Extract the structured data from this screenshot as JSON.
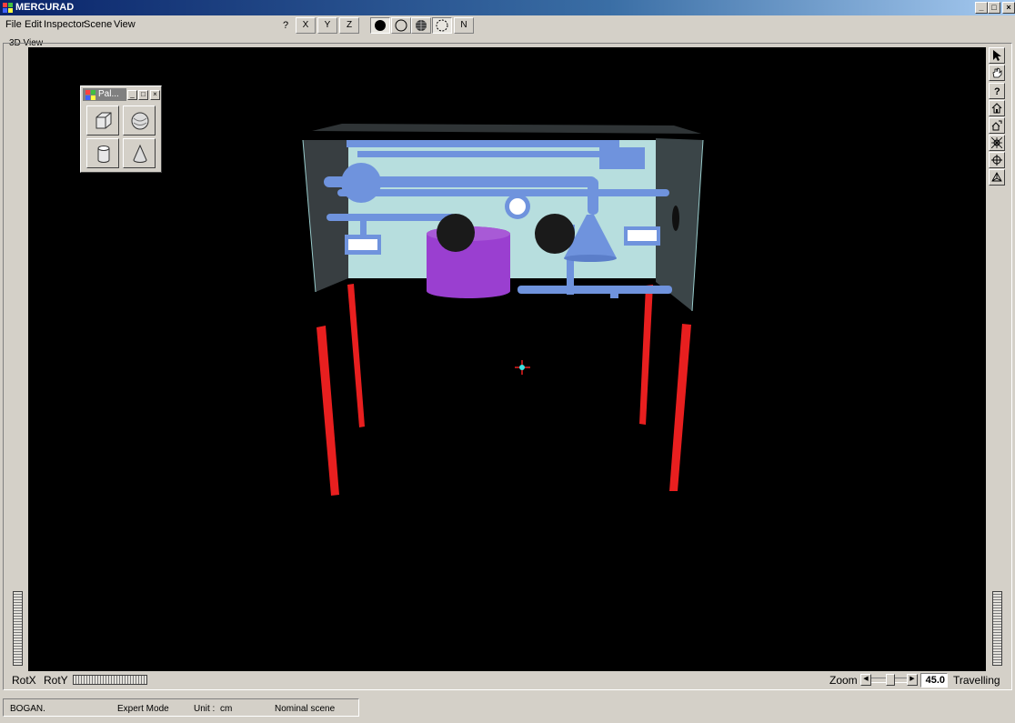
{
  "window": {
    "title": "MERCURAD"
  },
  "menu": {
    "items": [
      "File",
      "Edit",
      "Inspector",
      "Scene",
      "View"
    ],
    "help": "?"
  },
  "toolbar": {
    "axis_x": "X",
    "axis_y": "Y",
    "axis_z": "Z",
    "normal": "N"
  },
  "view": {
    "label": "3D View"
  },
  "palette": {
    "title": "Pal..."
  },
  "controls": {
    "rotx": "RotX",
    "roty": "RotY",
    "zoom": "Zoom",
    "zoom_value": "45.0",
    "travelling": "Travelling"
  },
  "status": {
    "user": "BOGAN.",
    "mode": "Expert Mode",
    "unit_label": "Unit :",
    "unit": "cm",
    "scene": "Nominal scene"
  },
  "colors": {
    "viewport_bg": "#000000",
    "pipe": "#6f93dd",
    "tank": "#9a3fd0",
    "legs": "#e81f1f",
    "back_panel": "#b7dede"
  },
  "icons": [
    "select-arrow-icon",
    "hand-pan-icon",
    "help-icon",
    "home-icon",
    "set-home-icon",
    "view-all-icon",
    "seek-icon",
    "perspective-icon",
    "cube-icon",
    "sphere-icon",
    "cylinder-icon",
    "cone-icon"
  ]
}
